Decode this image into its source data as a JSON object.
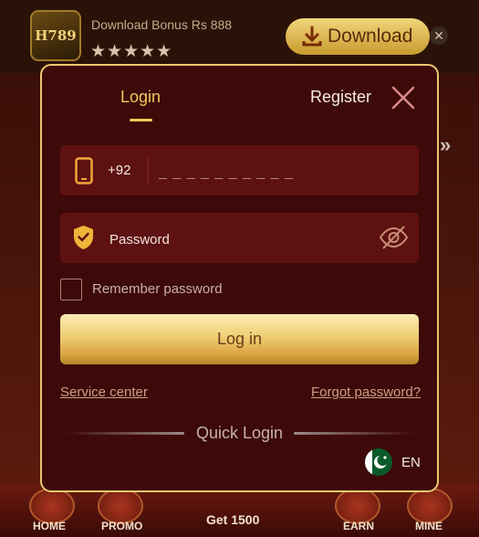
{
  "ad_bar": {
    "logo_text": "H789",
    "bonus_text": "Download Bonus Rs 888",
    "stars": "★★★★★",
    "download_label": "Download",
    "close_label": "✕"
  },
  "bottom_nav": {
    "home_label": "HOME",
    "promo_label": "PROMO",
    "get_label": "Get 1500",
    "earn_label": "EARN",
    "mine_label": "MINE"
  },
  "modal": {
    "tab_login": "Login",
    "tab_register": "Register",
    "country_code": "+92",
    "phone_placeholder": "_ _ _ _ _ _ _ _ _ _",
    "password_placeholder": "Password",
    "remember_label": "Remember password",
    "login_button": "Log in",
    "service_link": "Service center",
    "forgot_link": "Forgot password?",
    "quick_login": "Quick Login",
    "language": "EN"
  },
  "colors": {
    "accent_gold": "#f1c75b",
    "modal_bg": "#3e0909",
    "field_bg": "#5e1111",
    "border_gold": "#e9c86e"
  },
  "icons": [
    "download-icon",
    "phone-icon",
    "shield-check-icon",
    "eye-off-icon",
    "close-icon",
    "pakistan-flag-icon"
  ]
}
